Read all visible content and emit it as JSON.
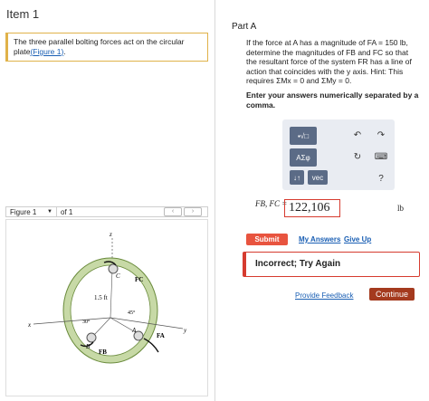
{
  "left_panel": {
    "item_title": "Item 1",
    "problem_text": "The three parallel bolting forces act on the circular plate",
    "figure_link": "Figure 1",
    "problem_suffix": ".",
    "figure_selector": {
      "label": "Figure 1",
      "of_text": "of 1"
    },
    "figure_labels": {
      "z_axis": "z",
      "x_axis": "x",
      "y_axis": "y",
      "radius": "1.5 ft",
      "angle_30": "30°",
      "angle_45": "45°",
      "point_a": "A",
      "point_b": "B",
      "point_c": "C",
      "force_fa": "FA",
      "force_fb": "FB",
      "force_fc": "FC"
    }
  },
  "right_panel": {
    "part_title": "Part A",
    "question_text": "If the force at A has a magnitude of FA = 150 lb, determine the magnitudes of FB and FC so that the resultant force of the system FR has a line of action that coincides with the y axis. Hint: This requires ΣMx = 0 and ΣMy = 0.",
    "instruction": "Enter your answers numerically separated by a comma.",
    "toolbar": {
      "btn_templates": "▪√□",
      "btn_symbols": "AΣφ",
      "btn_sort": "↓↑",
      "btn_vec": "vec",
      "btn_undo": "↶",
      "btn_redo": "↷",
      "btn_reset": "↻",
      "btn_keyboard": "⌨",
      "btn_help": "?"
    },
    "answer_label": "FB, FC =",
    "answer_value": "122,106",
    "units": "lb",
    "submit_label": "Submit",
    "my_answers": "My Answers",
    "give_up": "Give Up",
    "feedback": "Incorrect; Try Again",
    "provide_feedback": "Provide Feedback",
    "continue_label": "Continue"
  },
  "colors": {
    "accent_red": "#e8543f",
    "continue_bg": "#a43a1e",
    "link_blue": "#1a5fb4",
    "toolbar_btn": "#5b6b86"
  }
}
